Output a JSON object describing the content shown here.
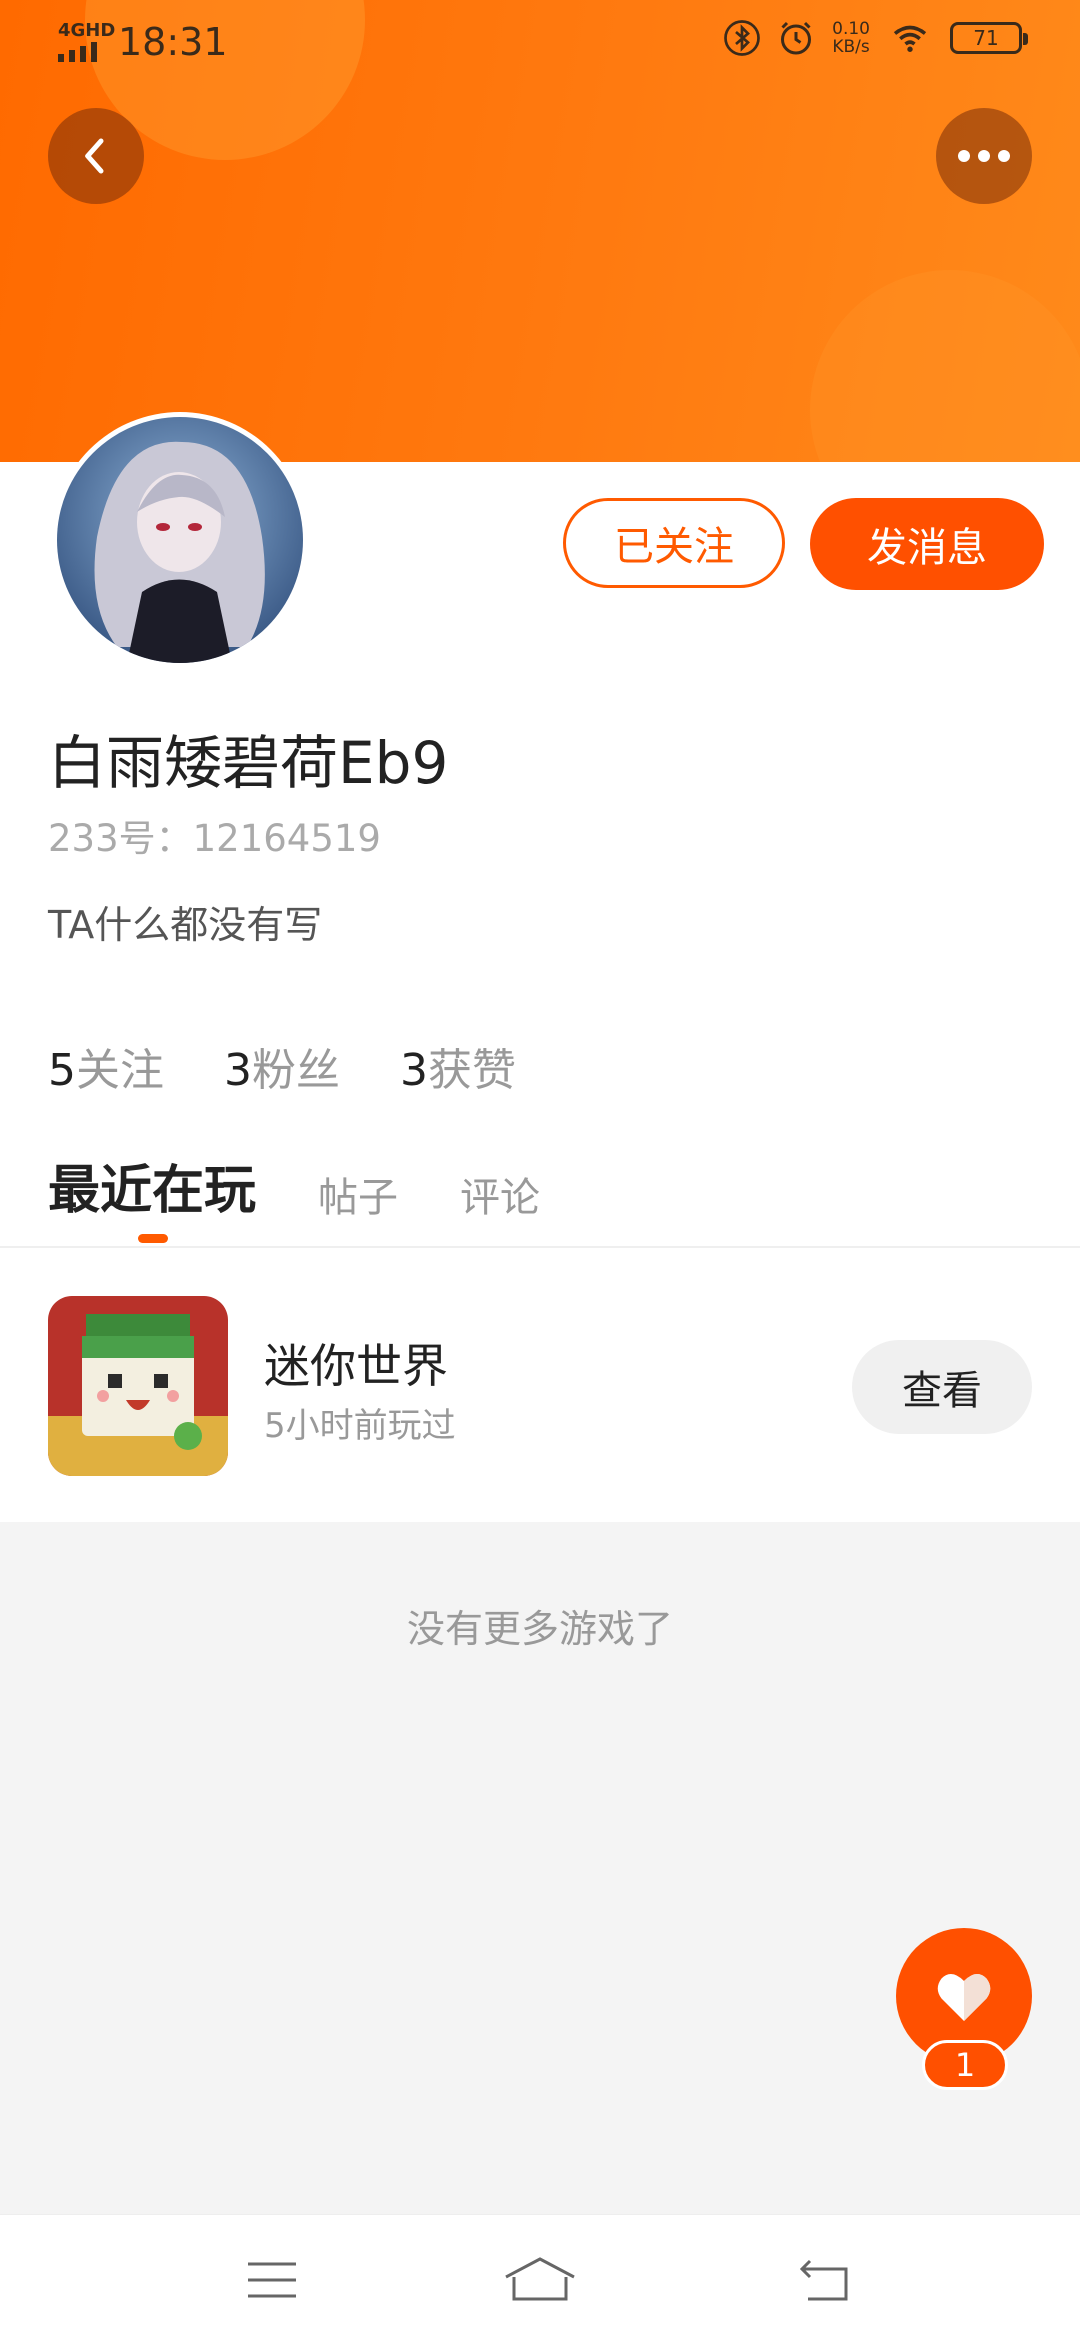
{
  "status_bar": {
    "network": "4GHD",
    "time": "18:31",
    "speed_value": "0.10",
    "speed_unit": "KB/s",
    "battery": "71"
  },
  "profile": {
    "username": "白雨矮碧荷Eb9",
    "uid": "233号：12164519",
    "bio": "TA什么都没有写",
    "followed_label": "已关注",
    "message_label": "发消息",
    "stats": [
      {
        "num": "5",
        "label": "关注"
      },
      {
        "num": "3",
        "label": "粉丝"
      },
      {
        "num": "3",
        "label": "获赞"
      }
    ]
  },
  "tabs": [
    {
      "label": "最近在玩",
      "active": true
    },
    {
      "label": "帖子",
      "active": false
    },
    {
      "label": "评论",
      "active": false
    }
  ],
  "game": {
    "title": "迷你世界",
    "subtitle": "5小时前玩过",
    "view_label": "查看"
  },
  "empty_text": "没有更多游戏了",
  "like_fab": {
    "count": "1"
  },
  "colors": {
    "accent": "#ff5000",
    "banner": "#ff7a10"
  }
}
